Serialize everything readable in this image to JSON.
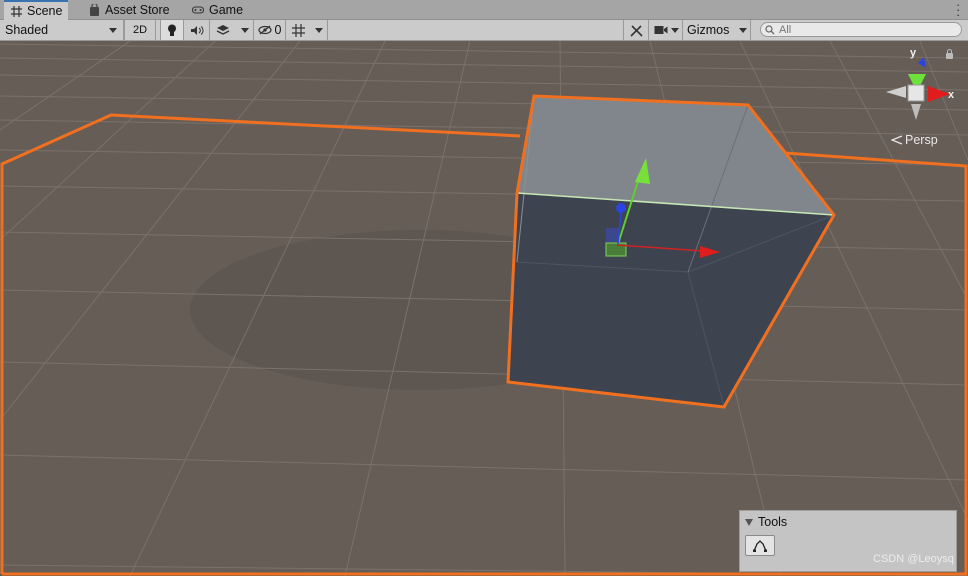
{
  "tabs": [
    {
      "label": "Scene",
      "icon": "grid-icon",
      "active": true
    },
    {
      "label": "Asset Store",
      "icon": "bag-icon",
      "active": false
    },
    {
      "label": "Game",
      "icon": "gamepad-icon",
      "active": false
    }
  ],
  "toolbar": {
    "draw_mode": "Shaded",
    "mode_2d": "2D",
    "hidden_count": "0",
    "gizmos_label": "Gizmos",
    "search_placeholder": "All"
  },
  "scene": {
    "background": "#655d56",
    "selection_outline": "#f07020",
    "projection_label": "Persp",
    "axis_y_label": "y",
    "axis_x_label": "x"
  },
  "tools_overlay": {
    "title": "Tools"
  },
  "watermark": "CSDN @Leoysq"
}
